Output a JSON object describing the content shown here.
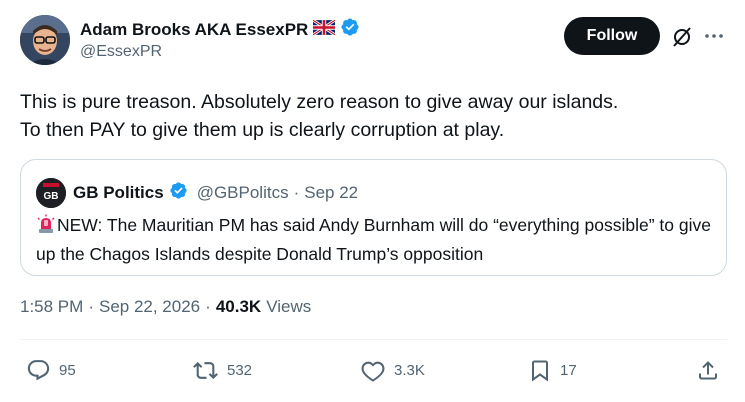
{
  "author": {
    "display_name": "Adam Brooks AKA EssexPR",
    "flag": "🇬🇧",
    "handle": "@EssexPR",
    "verified_color": "#1d9bf0"
  },
  "header": {
    "follow_label": "Follow",
    "grok_icon": "grok-icon",
    "more_icon": "more-icon"
  },
  "tweet": {
    "text": "This is pure treason. Absolutely zero reason to give away our islands.\nTo then PAY to give them up is clearly corruption at play."
  },
  "quote": {
    "avatar_label": "GB",
    "name": "GB Politics",
    "handle": "@GBPolitcs",
    "separator": "·",
    "date": "Sep 22",
    "siren_icon": "rotating-light-icon",
    "text": "NEW: The Mauritian PM has said Andy Burnham will do “everything possible” to give up the Chagos Islands despite Donald Trump’s opposition"
  },
  "meta": {
    "time": "1:58 PM",
    "separator": "·",
    "date": "Sep 22, 2026",
    "separator2": "·",
    "views_count": "40.3K",
    "views_label": "Views"
  },
  "actions": {
    "replies": "95",
    "reposts": "532",
    "likes": "3.3K",
    "bookmarks": "17"
  },
  "colors": {
    "text_primary": "#0f1419",
    "text_secondary": "#536471",
    "border": "#cfd9de",
    "accent": "#1d9bf0"
  }
}
